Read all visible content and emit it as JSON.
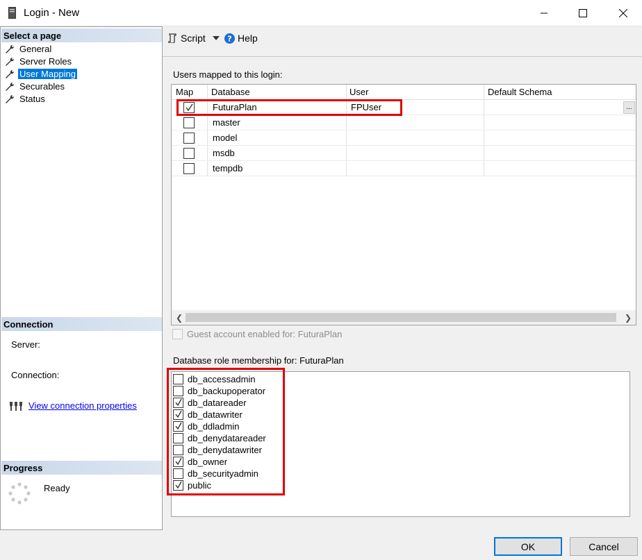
{
  "window": {
    "title": "Login - New"
  },
  "left": {
    "header": "Select a page",
    "nav": [
      {
        "label": "General",
        "icon": "wrench-icon",
        "selected": false
      },
      {
        "label": "Server Roles",
        "icon": "wrench-icon",
        "selected": false
      },
      {
        "label": "User Mapping",
        "icon": "wrench-icon",
        "selected": true
      },
      {
        "label": "Securables",
        "icon": "wrench-icon",
        "selected": false
      },
      {
        "label": "Status",
        "icon": "wrench-icon",
        "selected": false
      }
    ],
    "connection": {
      "header": "Connection",
      "server_label": "Server:",
      "connection_label": "Connection:",
      "link": "View connection properties"
    },
    "progress": {
      "header": "Progress",
      "status": "Ready"
    }
  },
  "toolbar": {
    "script": "Script",
    "help": "Help"
  },
  "mapping": {
    "label": "Users mapped to this login:",
    "columns": [
      "Map",
      "Database",
      "User",
      "Default Schema"
    ],
    "rows": [
      {
        "map": true,
        "database": "FuturaPlan",
        "user": "FPUser",
        "schema": ""
      },
      {
        "map": false,
        "database": "master",
        "user": "",
        "schema": ""
      },
      {
        "map": false,
        "database": "model",
        "user": "",
        "schema": ""
      },
      {
        "map": false,
        "database": "msdb",
        "user": "",
        "schema": ""
      },
      {
        "map": false,
        "database": "tempdb",
        "user": "",
        "schema": ""
      }
    ],
    "ellipsis": "..."
  },
  "guest": {
    "label": "Guest account enabled for: FuturaPlan",
    "checked": false,
    "enabled": false
  },
  "roles": {
    "label": "Database role membership for: FuturaPlan",
    "items": [
      {
        "name": "db_accessadmin",
        "checked": false
      },
      {
        "name": "db_backupoperator",
        "checked": false
      },
      {
        "name": "db_datareader",
        "checked": true
      },
      {
        "name": "db_datawriter",
        "checked": true
      },
      {
        "name": "db_ddladmin",
        "checked": true
      },
      {
        "name": "db_denydatareader",
        "checked": false
      },
      {
        "name": "db_denydatawriter",
        "checked": false
      },
      {
        "name": "db_owner",
        "checked": true
      },
      {
        "name": "db_securityadmin",
        "checked": false
      },
      {
        "name": "public",
        "checked": true
      }
    ]
  },
  "buttons": {
    "ok": "OK",
    "cancel": "Cancel"
  },
  "colors": {
    "selection": "#0078d7",
    "highlight": "#e00000",
    "link": "#0000ee"
  }
}
